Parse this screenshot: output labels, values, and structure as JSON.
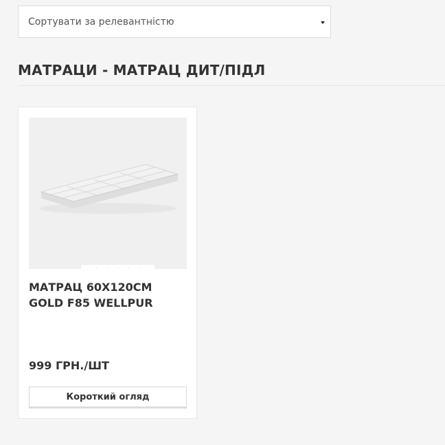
{
  "sort": {
    "selected": "Сортувати за релевантністю"
  },
  "category": {
    "title": "МАТРАЦИ - МАТРАЦ ДИТ/ПІДЛ"
  },
  "products": [
    {
      "name": "МАТРАЦ 60X120CM GOLD F85 WELLPUR",
      "price": "999 ГРН./ШТ",
      "rating": 5,
      "rating_max": 5,
      "quick_view_label": "Короткий огляд",
      "image": "mattress-product-photo"
    }
  ],
  "colors": {
    "background": "#f5f5f5",
    "star": "#f4b400",
    "text": "#333333"
  },
  "icons": {
    "dropdown": "caret-down-icon",
    "rating": "star-icon"
  }
}
